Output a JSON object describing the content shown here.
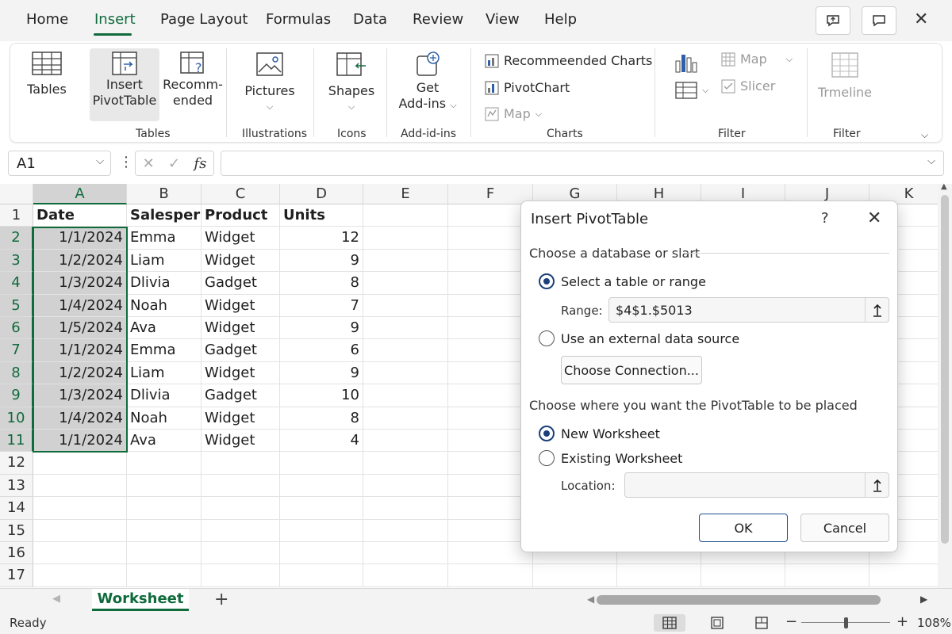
{
  "menu": {
    "tabs": [
      "Home",
      "Insert",
      "Page Layout",
      "Formulas",
      "Data",
      "Review",
      "View",
      "Help"
    ],
    "active": "Insert"
  },
  "ribbon": {
    "tables_btn": "Tables",
    "pivot_btn_l1": "Insert",
    "pivot_btn_l2": "PivotTable",
    "recommend_l1": "Recomm-",
    "recommend_l2": "ended",
    "pictures_btn": "Pictures",
    "shapes_btn": "Shapes",
    "addins_l1": "Get",
    "addins_l2": "Add-ins",
    "rec_charts": "Recommeended Charts",
    "pivotchart": "PivotChart",
    "map_chart": "Map",
    "map_filter": "Map",
    "slicer": "Slicer",
    "timeline": "Trmeline",
    "groups": {
      "tables": "Tables",
      "illustrations": "Illustrations",
      "icons": "Icons",
      "addins": "Add-id-ins",
      "charts": "Charts",
      "filter1": "Filter",
      "filter2": "Filter"
    }
  },
  "formula_bar": {
    "name_box": "A1",
    "fx": "fs",
    "value": ""
  },
  "grid": {
    "columns": [
      "A",
      "B",
      "C",
      "D",
      "E",
      "F",
      "G",
      "H",
      "I",
      "J",
      "K"
    ],
    "rows": [
      "1",
      "2",
      "3",
      "4",
      "5",
      "6",
      "7",
      "8",
      "9",
      "10",
      "11",
      "12",
      "13",
      "14",
      "15",
      "16",
      "17"
    ],
    "headers": [
      "Date",
      "Salesperson",
      "Product",
      "Units"
    ],
    "data": [
      [
        "1/1/2024",
        "Emma",
        "Widget",
        "12"
      ],
      [
        "1/2/2024",
        "Liam",
        "Widget",
        "9"
      ],
      [
        "1/3/2024",
        "Dlivia",
        "Gadget",
        "8"
      ],
      [
        "1/4/2024",
        "Noah",
        "Widget",
        "7"
      ],
      [
        "1/5/2024",
        "Ava",
        "Widget",
        "9"
      ],
      [
        "1/1/2024",
        "Emma",
        "Gadget",
        "6"
      ],
      [
        "1/2/2024",
        "Liam",
        "Widget",
        "9"
      ],
      [
        "1/3/2024",
        "Dlivia",
        "Gadget",
        "10"
      ],
      [
        "1/4/2024",
        "Noah",
        "Widget",
        "8"
      ],
      [
        "1/1/2024",
        "Ava",
        "Widget",
        "4"
      ]
    ]
  },
  "sheets": {
    "active": "Worksheet",
    "add": "+"
  },
  "status": {
    "ready": "Ready",
    "zoom": "108%",
    "zoom_minus": "−",
    "zoom_plus": "+"
  },
  "dialog": {
    "title": "Insert PivotTable",
    "help": "?",
    "close": "✕",
    "section1": "Choose a database or slart",
    "opt_table": "Select a table or range",
    "range_label": "Range:",
    "range_value": "$4$1.$5013",
    "opt_external": "Use an external data source",
    "choose_conn": "Choose Connection...",
    "section2": "Choose where you want the PivotTable to be placed",
    "opt_new": "New Worksheet",
    "opt_existing": "Existing Worksheet",
    "location_label": "Location:",
    "location_value": "",
    "ok": "OK",
    "cancel": "Cancel"
  },
  "colors": {
    "accent": "#106b3c",
    "selection_fill": "#d1d1d1",
    "radio_selected": "#1b3f7a"
  }
}
